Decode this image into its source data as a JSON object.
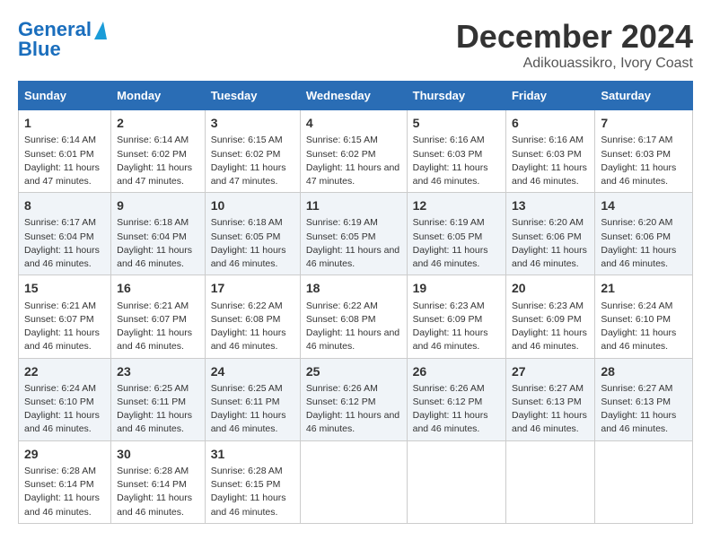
{
  "logo": {
    "line1": "General",
    "line2": "Blue"
  },
  "title": "December 2024",
  "subtitle": "Adikouassikro, Ivory Coast",
  "days_of_week": [
    "Sunday",
    "Monday",
    "Tuesday",
    "Wednesday",
    "Thursday",
    "Friday",
    "Saturday"
  ],
  "weeks": [
    [
      {
        "num": "1",
        "sunrise": "6:14 AM",
        "sunset": "6:01 PM",
        "daylight": "11 hours and 47 minutes."
      },
      {
        "num": "2",
        "sunrise": "6:14 AM",
        "sunset": "6:02 PM",
        "daylight": "11 hours and 47 minutes."
      },
      {
        "num": "3",
        "sunrise": "6:15 AM",
        "sunset": "6:02 PM",
        "daylight": "11 hours and 47 minutes."
      },
      {
        "num": "4",
        "sunrise": "6:15 AM",
        "sunset": "6:02 PM",
        "daylight": "11 hours and 47 minutes."
      },
      {
        "num": "5",
        "sunrise": "6:16 AM",
        "sunset": "6:03 PM",
        "daylight": "11 hours and 46 minutes."
      },
      {
        "num": "6",
        "sunrise": "6:16 AM",
        "sunset": "6:03 PM",
        "daylight": "11 hours and 46 minutes."
      },
      {
        "num": "7",
        "sunrise": "6:17 AM",
        "sunset": "6:03 PM",
        "daylight": "11 hours and 46 minutes."
      }
    ],
    [
      {
        "num": "8",
        "sunrise": "6:17 AM",
        "sunset": "6:04 PM",
        "daylight": "11 hours and 46 minutes."
      },
      {
        "num": "9",
        "sunrise": "6:18 AM",
        "sunset": "6:04 PM",
        "daylight": "11 hours and 46 minutes."
      },
      {
        "num": "10",
        "sunrise": "6:18 AM",
        "sunset": "6:05 PM",
        "daylight": "11 hours and 46 minutes."
      },
      {
        "num": "11",
        "sunrise": "6:19 AM",
        "sunset": "6:05 PM",
        "daylight": "11 hours and 46 minutes."
      },
      {
        "num": "12",
        "sunrise": "6:19 AM",
        "sunset": "6:05 PM",
        "daylight": "11 hours and 46 minutes."
      },
      {
        "num": "13",
        "sunrise": "6:20 AM",
        "sunset": "6:06 PM",
        "daylight": "11 hours and 46 minutes."
      },
      {
        "num": "14",
        "sunrise": "6:20 AM",
        "sunset": "6:06 PM",
        "daylight": "11 hours and 46 minutes."
      }
    ],
    [
      {
        "num": "15",
        "sunrise": "6:21 AM",
        "sunset": "6:07 PM",
        "daylight": "11 hours and 46 minutes."
      },
      {
        "num": "16",
        "sunrise": "6:21 AM",
        "sunset": "6:07 PM",
        "daylight": "11 hours and 46 minutes."
      },
      {
        "num": "17",
        "sunrise": "6:22 AM",
        "sunset": "6:08 PM",
        "daylight": "11 hours and 46 minutes."
      },
      {
        "num": "18",
        "sunrise": "6:22 AM",
        "sunset": "6:08 PM",
        "daylight": "11 hours and 46 minutes."
      },
      {
        "num": "19",
        "sunrise": "6:23 AM",
        "sunset": "6:09 PM",
        "daylight": "11 hours and 46 minutes."
      },
      {
        "num": "20",
        "sunrise": "6:23 AM",
        "sunset": "6:09 PM",
        "daylight": "11 hours and 46 minutes."
      },
      {
        "num": "21",
        "sunrise": "6:24 AM",
        "sunset": "6:10 PM",
        "daylight": "11 hours and 46 minutes."
      }
    ],
    [
      {
        "num": "22",
        "sunrise": "6:24 AM",
        "sunset": "6:10 PM",
        "daylight": "11 hours and 46 minutes."
      },
      {
        "num": "23",
        "sunrise": "6:25 AM",
        "sunset": "6:11 PM",
        "daylight": "11 hours and 46 minutes."
      },
      {
        "num": "24",
        "sunrise": "6:25 AM",
        "sunset": "6:11 PM",
        "daylight": "11 hours and 46 minutes."
      },
      {
        "num": "25",
        "sunrise": "6:26 AM",
        "sunset": "6:12 PM",
        "daylight": "11 hours and 46 minutes."
      },
      {
        "num": "26",
        "sunrise": "6:26 AM",
        "sunset": "6:12 PM",
        "daylight": "11 hours and 46 minutes."
      },
      {
        "num": "27",
        "sunrise": "6:27 AM",
        "sunset": "6:13 PM",
        "daylight": "11 hours and 46 minutes."
      },
      {
        "num": "28",
        "sunrise": "6:27 AM",
        "sunset": "6:13 PM",
        "daylight": "11 hours and 46 minutes."
      }
    ],
    [
      {
        "num": "29",
        "sunrise": "6:28 AM",
        "sunset": "6:14 PM",
        "daylight": "11 hours and 46 minutes."
      },
      {
        "num": "30",
        "sunrise": "6:28 AM",
        "sunset": "6:14 PM",
        "daylight": "11 hours and 46 minutes."
      },
      {
        "num": "31",
        "sunrise": "6:28 AM",
        "sunset": "6:15 PM",
        "daylight": "11 hours and 46 minutes."
      },
      null,
      null,
      null,
      null
    ]
  ]
}
